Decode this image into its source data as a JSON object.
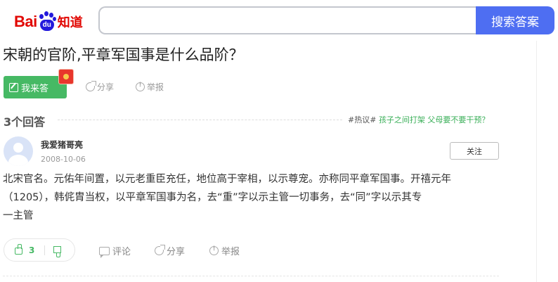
{
  "header": {
    "logo_bai": "Bai",
    "logo_du": "du",
    "logo_zhidao": "知道",
    "search_value": "",
    "search_button": "搜索答案"
  },
  "question": {
    "title": "宋朝的官阶,平章军国事是什么品阶？",
    "answer_button": "我来答",
    "share": "分享",
    "report": "举报"
  },
  "answers_header": {
    "count": "3个回答",
    "hot_tag": "#热议#",
    "hot_topic": "孩子之间打架 父母要不要干预？"
  },
  "answer": {
    "username": "我爱猪哥亮",
    "date": "2008-10-06",
    "follow": "关注",
    "line1": "北宋官名。元佑年间置，以元老重臣充任，地位高于宰相，以示尊宠。亦称同平章军国事。开禧元年",
    "line2": "（1205），韩侂胄当权，以平章军国事为名，去“重”字以示主管一切事务，去“同”字以示其专",
    "line3": "一主管",
    "upvotes": "3",
    "comment": "评论",
    "share": "分享",
    "report": "举报"
  },
  "colors": {
    "accent": "#4e6ef2",
    "green": "#46b964",
    "logo_red": "#e10601",
    "logo_blue": "#2319dc"
  }
}
